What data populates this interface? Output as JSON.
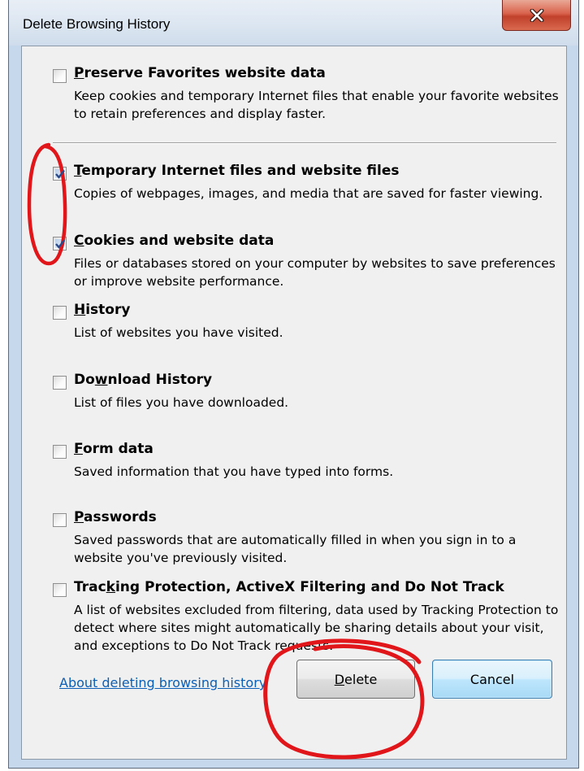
{
  "window": {
    "title": "Delete Browsing History"
  },
  "close_button": {
    "icon": "close-icon"
  },
  "options": [
    {
      "id": "preserve-favorites",
      "label_pre": "",
      "label_ul": "P",
      "label_post": "reserve Favorites website data",
      "description": "Keep cookies and temporary Internet files that enable your favorite websites to retain preferences and display faster.",
      "checked": false
    },
    {
      "id": "temporary-files",
      "label_pre": "",
      "label_ul": "T",
      "label_post": "emporary Internet files and website files",
      "description": "Copies of webpages, images, and media that are saved for faster viewing.",
      "checked": true
    },
    {
      "id": "cookies",
      "label_pre": "",
      "label_ul": "C",
      "label_post": "ookies and website data",
      "description": "Files or databases stored on your computer by websites to save preferences or improve website performance.",
      "checked": true
    },
    {
      "id": "history",
      "label_pre": "",
      "label_ul": "H",
      "label_post": "istory",
      "description": "List of websites you have visited.",
      "checked": false
    },
    {
      "id": "download-history",
      "label_pre": "Do",
      "label_ul": "w",
      "label_post": "nload History",
      "description": "List of files you have downloaded.",
      "checked": false
    },
    {
      "id": "form-data",
      "label_pre": "",
      "label_ul": "F",
      "label_post": "orm data",
      "description": "Saved information that you have typed into forms.",
      "checked": false
    },
    {
      "id": "passwords",
      "label_pre": "",
      "label_ul": "P",
      "label_post": "asswords",
      "description": "Saved passwords that are automatically filled in when you sign in to a website you've previously visited.",
      "checked": false
    },
    {
      "id": "tracking-protection",
      "label_pre": "Trac",
      "label_ul": "k",
      "label_post": "ing Protection, ActiveX Filtering and Do Not Track",
      "description": "A list of websites excluded from filtering, data used by Tracking Protection to detect where sites might automatically be sharing details about your visit, and exceptions to Do Not Track requests.",
      "checked": false
    }
  ],
  "footer": {
    "help_link": "About deleting browsing history",
    "delete_ul": "D",
    "delete_rest": "elete",
    "cancel_label": "Cancel"
  },
  "colors": {
    "annotation": "#e0161b",
    "link": "#0b5fb7",
    "check": "#2b4a8a"
  }
}
